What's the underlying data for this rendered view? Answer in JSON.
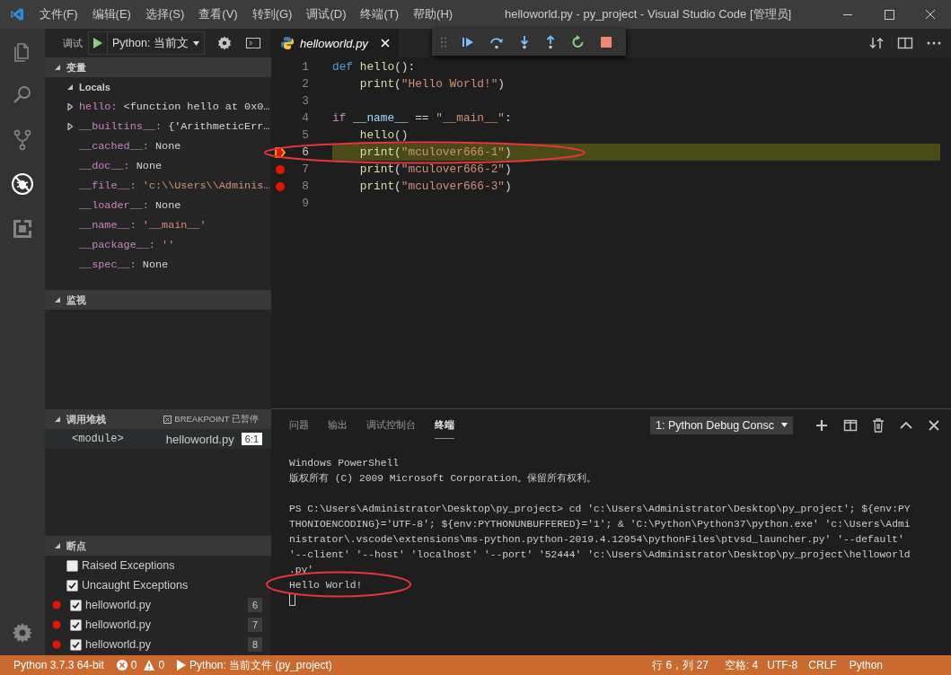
{
  "window": {
    "title": "helloworld.py - py_project - Visual Studio Code [管理员]"
  },
  "menu": [
    "文件(F)",
    "编辑(E)",
    "选择(S)",
    "查看(V)",
    "转到(G)",
    "调试(D)",
    "终端(T)",
    "帮助(H)"
  ],
  "activity_bar": [
    {
      "kind": "files",
      "selected": false
    },
    {
      "kind": "search",
      "selected": false
    },
    {
      "kind": "source-control",
      "selected": false
    },
    {
      "kind": "debug",
      "selected": true
    },
    {
      "kind": "extensions",
      "selected": false
    }
  ],
  "debug_toolbar": {
    "label": "调试",
    "configuration": "Python: 当前文"
  },
  "variables": {
    "title": "变量",
    "expanded": true,
    "scope": {
      "label": "Locals",
      "expanded": true
    },
    "items": [
      {
        "name": "hello:",
        "value": "<function hello at 0x0…",
        "kind": "object",
        "expandable": true
      },
      {
        "name": "__builtins__:",
        "value": "{'ArithmeticErr…",
        "kind": "object",
        "expandable": true
      },
      {
        "name": "__cached__:",
        "value": "None",
        "kind": "object",
        "expandable": false
      },
      {
        "name": "__doc__:",
        "value": "None",
        "kind": "object",
        "expandable": false
      },
      {
        "name": "__file__:",
        "value": "'c:\\\\Users\\\\Adminis…",
        "kind": "string",
        "expandable": false
      },
      {
        "name": "__loader__:",
        "value": "None",
        "kind": "object",
        "expandable": false
      },
      {
        "name": "__name__:",
        "value": "'__main__'",
        "kind": "string",
        "expandable": false
      },
      {
        "name": "__package__:",
        "value": "''",
        "kind": "string",
        "expandable": false
      },
      {
        "name": "__spec__:",
        "value": "None",
        "kind": "object",
        "expandable": false
      }
    ]
  },
  "watch": {
    "title": "监视",
    "expanded": true
  },
  "call_stack": {
    "title": "调用堆栈",
    "expanded": true,
    "status": "BREAKPOINT 已暂停",
    "frames": [
      {
        "name": "<module>",
        "file": "helloworld.py",
        "position": "6:1"
      }
    ]
  },
  "breakpoints": {
    "title": "断点",
    "expanded": true,
    "items": [
      {
        "kind": "exception",
        "label": "Raised Exceptions",
        "checked": false
      },
      {
        "kind": "exception",
        "label": "Uncaught Exceptions",
        "checked": true
      },
      {
        "kind": "line",
        "label": "helloworld.py",
        "checked": true,
        "line": "6"
      },
      {
        "kind": "line",
        "label": "helloworld.py",
        "checked": true,
        "line": "7"
      },
      {
        "kind": "line",
        "label": "helloworld.py",
        "checked": true,
        "line": "8"
      }
    ]
  },
  "editor": {
    "tabs": [
      {
        "label": "helloworld.py",
        "selected": true
      }
    ],
    "lines": [
      {
        "number": "1",
        "breakpoint": false,
        "current": false,
        "indented": false,
        "tokens": [
          {
            "text": "def ",
            "kind": "keyword"
          },
          {
            "text": "hello",
            "kind": "function"
          },
          {
            "text": "():",
            "kind": "plain"
          }
        ]
      },
      {
        "number": "2",
        "breakpoint": false,
        "current": false,
        "indented": true,
        "tokens": [
          {
            "text": "print",
            "kind": "function"
          },
          {
            "text": "(",
            "kind": "plain"
          },
          {
            "text": "\"Hello World!\"",
            "kind": "string"
          },
          {
            "text": ")",
            "kind": "plain"
          }
        ]
      },
      {
        "number": "3",
        "breakpoint": false,
        "current": false
      },
      {
        "number": "4",
        "breakpoint": false,
        "current": false,
        "indented": false,
        "tokens": [
          {
            "text": "if ",
            "kind": "control"
          },
          {
            "text": "__name__",
            "kind": "variable"
          },
          {
            "text": " == ",
            "kind": "plain"
          },
          {
            "text": "\"__main__\"",
            "kind": "string"
          },
          {
            "text": ":",
            "kind": "plain"
          }
        ]
      },
      {
        "number": "5",
        "breakpoint": false,
        "current": false,
        "indented": true,
        "tokens": [
          {
            "text": "hello",
            "kind": "function"
          },
          {
            "text": "()",
            "kind": "plain"
          }
        ]
      },
      {
        "number": "6",
        "breakpoint": true,
        "current": true,
        "indented": true,
        "tokens": [
          {
            "text": "print",
            "kind": "function"
          },
          {
            "text": "(",
            "kind": "plain"
          },
          {
            "text": "\"mculover666-1\"",
            "kind": "string"
          },
          {
            "text": ")",
            "kind": "plain"
          }
        ]
      },
      {
        "number": "7",
        "breakpoint": true,
        "current": false,
        "indented": true,
        "tokens": [
          {
            "text": "print",
            "kind": "function"
          },
          {
            "text": "(",
            "kind": "plain"
          },
          {
            "text": "\"mculover666-2\"",
            "kind": "string"
          },
          {
            "text": ")",
            "kind": "plain"
          }
        ]
      },
      {
        "number": "8",
        "breakpoint": true,
        "current": false,
        "indented": true,
        "tokens": [
          {
            "text": "print",
            "kind": "function"
          },
          {
            "text": "(",
            "kind": "plain"
          },
          {
            "text": "\"mculover666-3\"",
            "kind": "string"
          },
          {
            "text": ")",
            "kind": "plain"
          }
        ]
      },
      {
        "number": "9",
        "breakpoint": false,
        "current": false
      }
    ]
  },
  "panel": {
    "tabs": [
      {
        "label": "问题",
        "selected": false
      },
      {
        "label": "输出",
        "selected": false
      },
      {
        "label": "调试控制台",
        "selected": false
      },
      {
        "label": "终端",
        "selected": true
      }
    ],
    "terminal_select": "1: Python Debug Consc",
    "terminal": [
      {
        "text": "Windows PowerShell",
        "space_before": false
      },
      {
        "text": "版权所有 (C) 2009 Microsoft Corporation。保留所有权利。",
        "space_before": false
      },
      {
        "text": "PS C:\\Users\\Administrator\\Desktop\\py_project> cd 'c:\\Users\\Administrator\\Desktop\\py_project'; ${env:PY",
        "space_before": true
      },
      {
        "text": "THONIOENCODING}='UTF-8'; ${env:PYTHONUNBUFFERED}='1'; & 'C:\\Python\\Python37\\python.exe' 'c:\\Users\\Admi",
        "space_before": false
      },
      {
        "text": "nistrator\\.vscode\\extensions\\ms-python.python-2019.4.12954\\pythonFiles\\ptvsd_launcher.py' '--default'",
        "space_before": false
      },
      {
        "text": "'--client' '--host' 'localhost' '--port' '52444' 'c:\\Users\\Administrator\\Desktop\\py_project\\helloworld",
        "space_before": false
      },
      {
        "text": ".py'",
        "space_before": false
      },
      {
        "text": "Hello World!",
        "space_before": false
      }
    ]
  },
  "status_bar": {
    "interpreter": "Python 3.7.3 64-bit",
    "errors": "0",
    "warnings": "0",
    "launch": "Python: 当前文件 (py_project)",
    "position": "行 6，列 27",
    "indent": "空格: 4",
    "encoding": "UTF-8",
    "eol": "CRLF",
    "language": "Python"
  }
}
